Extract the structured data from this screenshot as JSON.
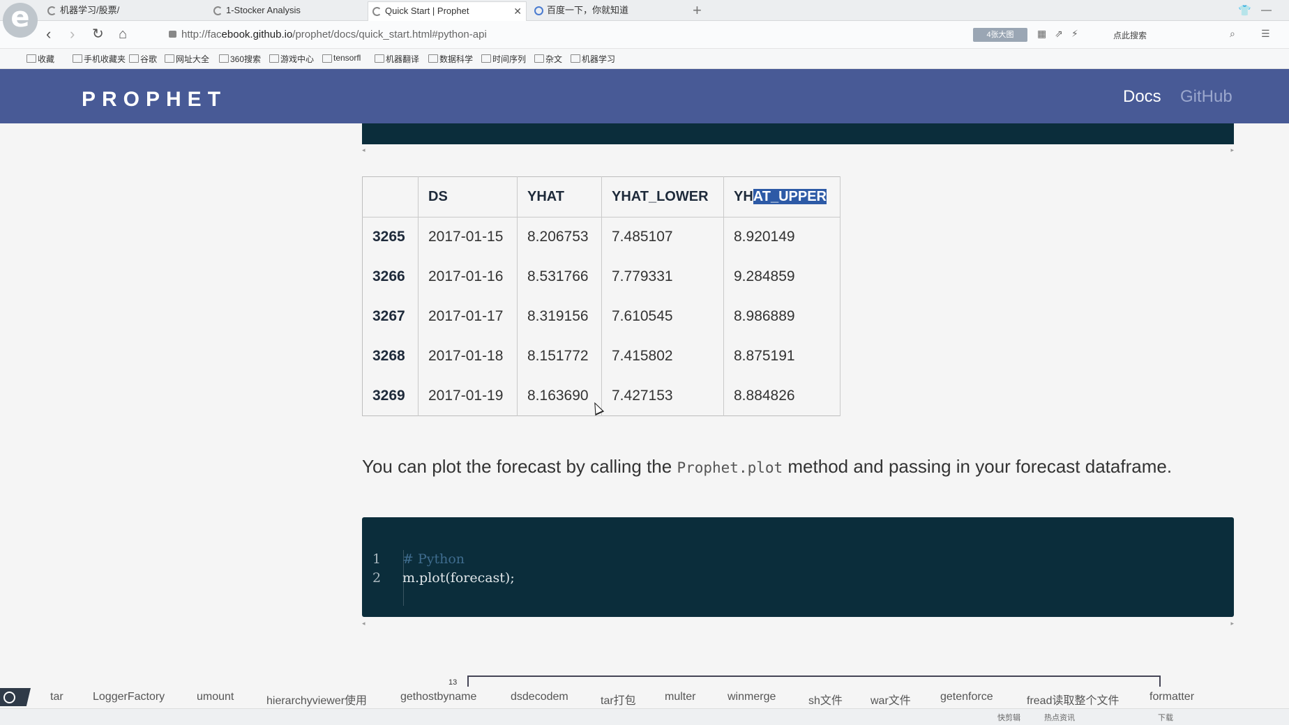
{
  "browser": {
    "tabs": [
      {
        "label": "机器学习/股票/"
      },
      {
        "label": "1-Stocker Analysis"
      },
      {
        "label": "Quick Start | Prophet"
      },
      {
        "label": "百度一下，你就知道"
      }
    ],
    "new_tab_label": "+",
    "url_prefix": "http://fac",
    "url_mid": "ebook.github.io",
    "url_rest": "/prophet/docs/quick_start.html#python-api",
    "ext_badge": "4张大图",
    "search_hint": "点此搜索",
    "bookmarks": [
      "收藏",
      "手机收藏夹",
      "谷歌",
      "网址大全",
      "360搜索",
      "游戏中心",
      "tensorfl",
      "机器翻译",
      "数据科学",
      "时间序列",
      "杂文",
      "机器学习"
    ]
  },
  "site": {
    "logo": "PROPHET",
    "nav": {
      "docs": "Docs",
      "github": "GitHub"
    }
  },
  "table": {
    "headers": [
      "",
      "DS",
      "YHAT",
      "YHAT_LOWER",
      "YHAT_UPPER"
    ],
    "header_last_plain": "YH",
    "header_last_selected": "AT_UPPER",
    "rows": [
      {
        "index": "3265",
        "ds": "2017-01-15",
        "yhat": "8.206753",
        "yhat_lower": "7.485107",
        "yhat_upper": "8.920149"
      },
      {
        "index": "3266",
        "ds": "2017-01-16",
        "yhat": "8.531766",
        "yhat_lower": "7.779331",
        "yhat_upper": "9.284859"
      },
      {
        "index": "3267",
        "ds": "2017-01-17",
        "yhat": "8.319156",
        "yhat_lower": "7.610545",
        "yhat_upper": "8.986889"
      },
      {
        "index": "3268",
        "ds": "2017-01-18",
        "yhat": "8.151772",
        "yhat_lower": "7.415802",
        "yhat_upper": "8.875191"
      },
      {
        "index": "3269",
        "ds": "2017-01-19",
        "yhat": "8.163690",
        "yhat_lower": "7.427153",
        "yhat_upper": "8.884826"
      }
    ]
  },
  "paragraph": {
    "before": "You can plot the forecast by calling the ",
    "code": "Prophet.plot",
    "after": " method and passing in your forecast dataframe."
  },
  "code_block": {
    "line_numbers": [
      "1",
      "2"
    ],
    "comment": "# Python",
    "code": "m.plot(forecast);"
  },
  "bracket_number": "13",
  "taskbar": [
    "tar",
    "LoggerFactory",
    "umount",
    "hierarchyviewer使用",
    "gethostbyname",
    "dsdecodem",
    "tar打包",
    "multer",
    "winmerge",
    "sh文件",
    "war文件",
    "getenforce",
    "fread读取整个文件",
    "formatter"
  ],
  "statusbar": [
    "快剪辑",
    "热点资讯",
    "下载"
  ],
  "colors": {
    "header": "#485a96",
    "code_bg": "#0b2d3b",
    "selection": "#2d5aa6"
  }
}
